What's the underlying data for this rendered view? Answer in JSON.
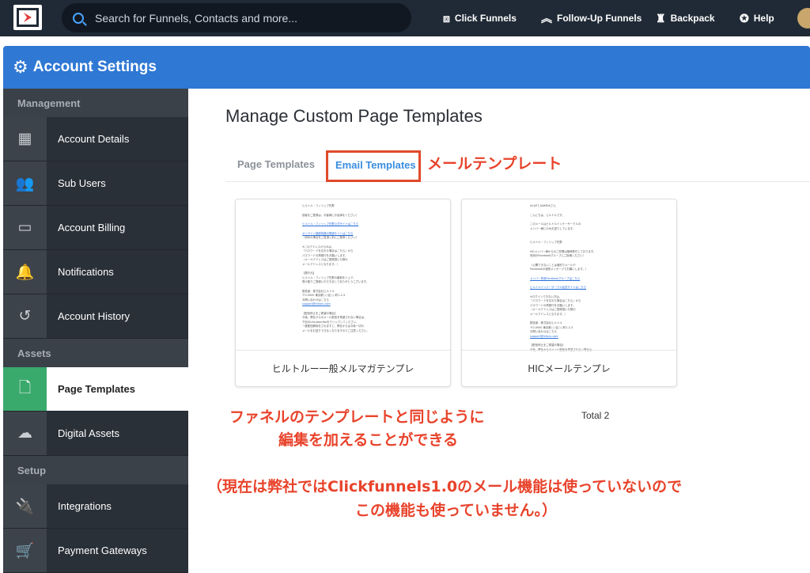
{
  "topbar": {
    "search_placeholder": "Search for Funnels, Contacts and more...",
    "nav": [
      {
        "label": "Click Funnels",
        "icon": "clickfunnels-icon"
      },
      {
        "label": "Follow-Up Funnels",
        "icon": "follow-up-icon"
      },
      {
        "label": "Backpack",
        "icon": "backpack-icon"
      },
      {
        "label": "Help",
        "icon": "help-icon"
      }
    ]
  },
  "header": {
    "title": "Account Settings",
    "icon": "gears-icon"
  },
  "sidebar": {
    "sections": [
      {
        "label": "Management",
        "items": [
          {
            "label": "Account Details",
            "icon": "building-icon"
          },
          {
            "label": "Sub Users",
            "icon": "users-icon"
          },
          {
            "label": "Account Billing",
            "icon": "credit-card-icon"
          },
          {
            "label": "Notifications",
            "icon": "bell-icon"
          },
          {
            "label": "Account History",
            "icon": "history-icon"
          }
        ]
      },
      {
        "label": "Assets",
        "items": [
          {
            "label": "Page Templates",
            "icon": "file-icon"
          },
          {
            "label": "Digital Assets",
            "icon": "cloud-download-icon"
          }
        ]
      },
      {
        "label": "Setup",
        "items": [
          {
            "label": "Integrations",
            "icon": "plug-icon"
          },
          {
            "label": "Payment Gateways",
            "icon": "cart-icon"
          }
        ]
      }
    ]
  },
  "main": {
    "title": "Manage Custom Page Templates",
    "tabs": [
      {
        "label": "Page Templates",
        "active": false
      },
      {
        "label": "Email Templates",
        "active": true
      }
    ],
    "cards": [
      {
        "name": "ヒルトルー一般メルマガテンプレ"
      },
      {
        "name": "HICメールテンプレ"
      }
    ],
    "total": "Total 2"
  },
  "annotations": {
    "mail_template": "メールテンプレート",
    "edit_line1": "ファネルのテンプレートと同じように",
    "edit_line2": "編集を加えることができる",
    "cf_line1": "（現在は弊社ではClickfunnels1.0のメール機能は使っていないので",
    "cf_line2": "この機能も使っていません。）"
  },
  "colors": {
    "topbar": "#202a36",
    "header": "#2f78d4",
    "sidebar": "#2a3038",
    "active_green": "#3aa96c",
    "tab_blue": "#3a8de0",
    "annotation_red": "#e8432b"
  }
}
